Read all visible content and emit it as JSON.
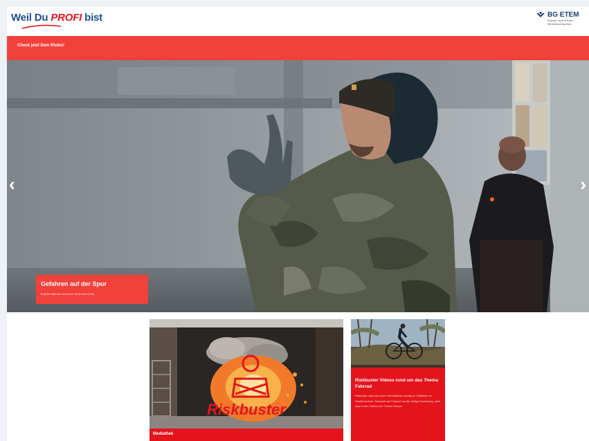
{
  "header": {
    "logo_part1": "Weil Du ",
    "logo_part2": "PROFI",
    "logo_part3": " bist",
    "brand_name_line1": "BG ETEM",
    "brand_sub": "Energie Textil Elektro Medienerzeugnisse"
  },
  "nav": {
    "link_label": "Check jetzt Dein Risiko!"
  },
  "hero": {
    "caption_title": "Gefahren auf der Spur",
    "caption_sub": "Begleite Riskbuster bei seinem Sicherheits-Check"
  },
  "cards": [
    {
      "image_word": "Riskbuster",
      "footer_label": "Mediathek"
    },
    {
      "title": "Riskbuster Videos rund um das Thema Fahrrad",
      "text": "Riskbuster weiß was beim Fahrradfahren wichtig ist. Radfahrer im Straßenverkehr, Sicherheit am Fahrrad und die richtige Ausrüstung, mehr dazu in den Videos zum Thema Fahrrad."
    }
  ],
  "colors": {
    "brand_red": "#f2403a",
    "dark_red": "#e3141b",
    "brand_blue": "#1d4e8f"
  },
  "icons": {
    "prev": "chevron-left-icon",
    "next": "chevron-right-icon",
    "brand": "bg-etem-logo-icon"
  }
}
